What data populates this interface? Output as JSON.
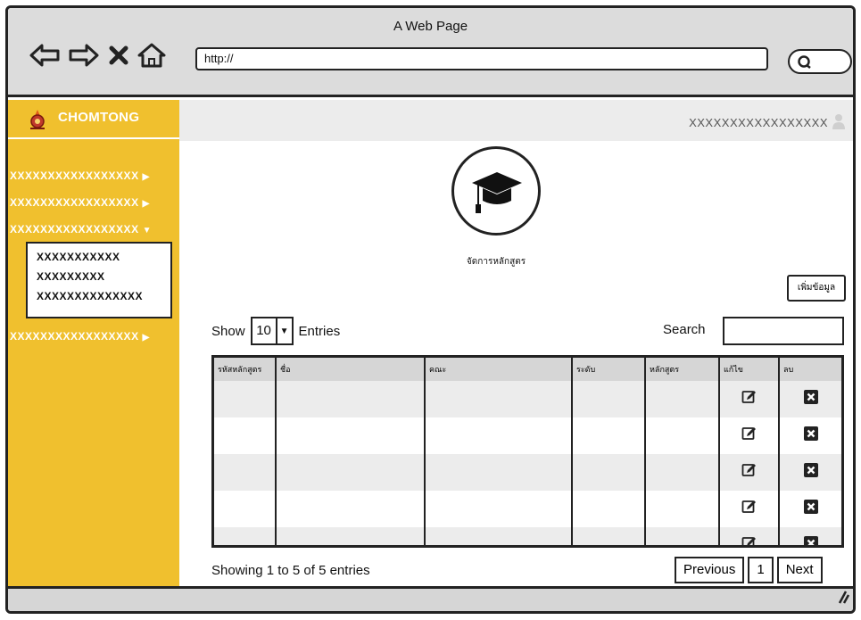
{
  "browser": {
    "title": "A Web Page",
    "url": "http://"
  },
  "brand": {
    "name": "CHOMTONG"
  },
  "topbar": {
    "user": "XXXXXXXXXXXXXXXXX"
  },
  "sidebar": {
    "items": [
      {
        "label": "XXXXXXXXXXXXXXXXX"
      },
      {
        "label": "XXXXXXXXXXXXXXXXX"
      },
      {
        "label": "XXXXXXXXXXXXXXXXX"
      },
      {
        "label": "XXXXXXXXXXXXXXXXX"
      }
    ],
    "submenu": [
      {
        "label": "XXXXXXXXXXX"
      },
      {
        "label": "XXXXXXXXX"
      },
      {
        "label": "XXXXXXXXXXXXXX"
      }
    ]
  },
  "page": {
    "heading": "จัดการหลักสูตร",
    "add_button": "เพิ่มข้อมูล"
  },
  "controls": {
    "show_label": "Show",
    "entries_value": "10",
    "entries_label": "Entries",
    "search_label": "Search"
  },
  "table": {
    "columns": [
      "รหัสหลักสูตร",
      "ชื่อ",
      "คณะ",
      "ระดับ",
      "หลักสูตร",
      "แก้ไข",
      "ลบ"
    ]
  },
  "footer": {
    "info": "Showing 1 to 5 of 5 entries",
    "prev": "Previous",
    "page": "1",
    "next": "Next"
  }
}
